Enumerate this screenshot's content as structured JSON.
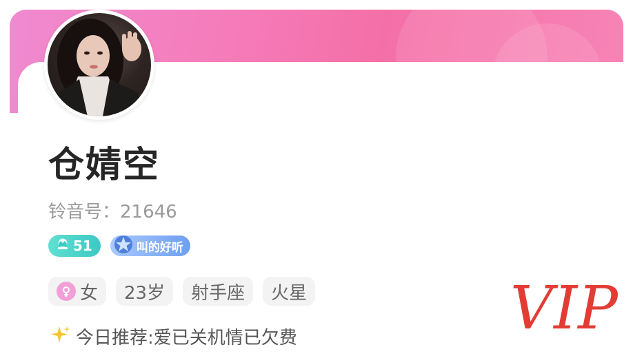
{
  "profile": {
    "name": "仓婧空",
    "id_label": "铃音号：",
    "id_value": "21646",
    "level": "51",
    "voice_badge": "叫的好听",
    "tags": {
      "gender": "女",
      "age": "23岁",
      "zodiac": "射手座",
      "planet": "火星"
    },
    "recommend": "今日推荐:爱已关机情已欠费"
  },
  "overlay": {
    "vip_text": "VIP"
  },
  "colors": {
    "banner": "#f57cba",
    "level_badge": "#3ec8c4",
    "voice_badge": "#6f9ff0",
    "gender_icon": "#f19fd6",
    "vip": "#e23c35"
  },
  "icons": {
    "level": "crown-icon",
    "voice": "star-badge-icon",
    "gender": "female-icon",
    "recommend": "sparkle-icon"
  }
}
